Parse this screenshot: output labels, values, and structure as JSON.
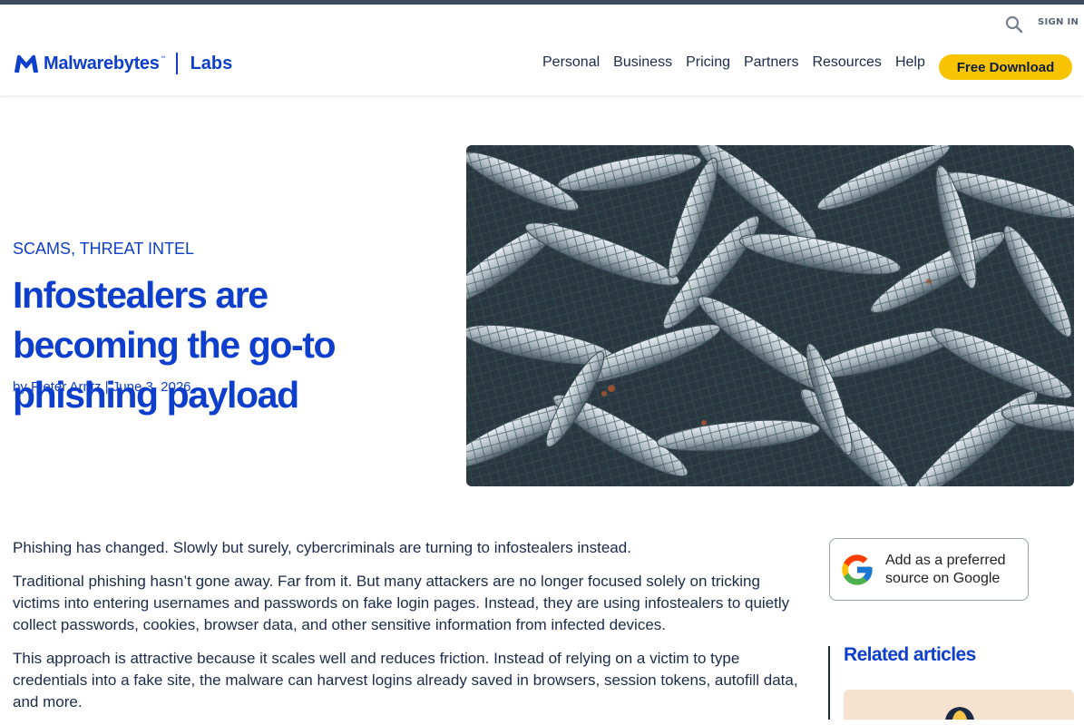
{
  "header": {
    "signin_label": "SIGN IN",
    "logo_text": "Malwarebytes",
    "logo_tm": "™",
    "logo_sub": "Labs",
    "nav": [
      "Personal",
      "Business",
      "Pricing",
      "Partners",
      "Resources",
      "Help"
    ],
    "cta_label": "Free Download"
  },
  "article": {
    "category": "SCAMS, THREAT INTEL",
    "title": "Infostealers are becoming the go-to phishing payload",
    "byline": "by Pieter Arntz | June 3, 2026",
    "paragraphs": [
      "Phishing has changed. Slowly but surely, cybercriminals are turning to infostealers instead.",
      "Traditional phishing hasn’t gone away. Far from it. But many attackers are no longer focused solely on tricking victims into entering usernames and passwords on fake login pages. Instead, they are using infostealers to quietly collect passwords, cookies, browser data, and other sensitive information from infected devices.",
      "This approach is attractive because it scales well and reduces friction. Instead of relying on a victim to type credentials into a fake site, the malware can harvest logins already saved in browsers, session tokens, autofill data, and more."
    ]
  },
  "sidebar": {
    "google_badge": "Add as a preferred source on Google",
    "related_title": "Related articles"
  },
  "colors": {
    "brand": "#0d3ecc",
    "cta": "#f8c300",
    "text": "#1a2b4a"
  },
  "icons": {
    "search": "search-icon",
    "logo": "malwarebytes-logo-icon",
    "google": "google-g-icon"
  }
}
